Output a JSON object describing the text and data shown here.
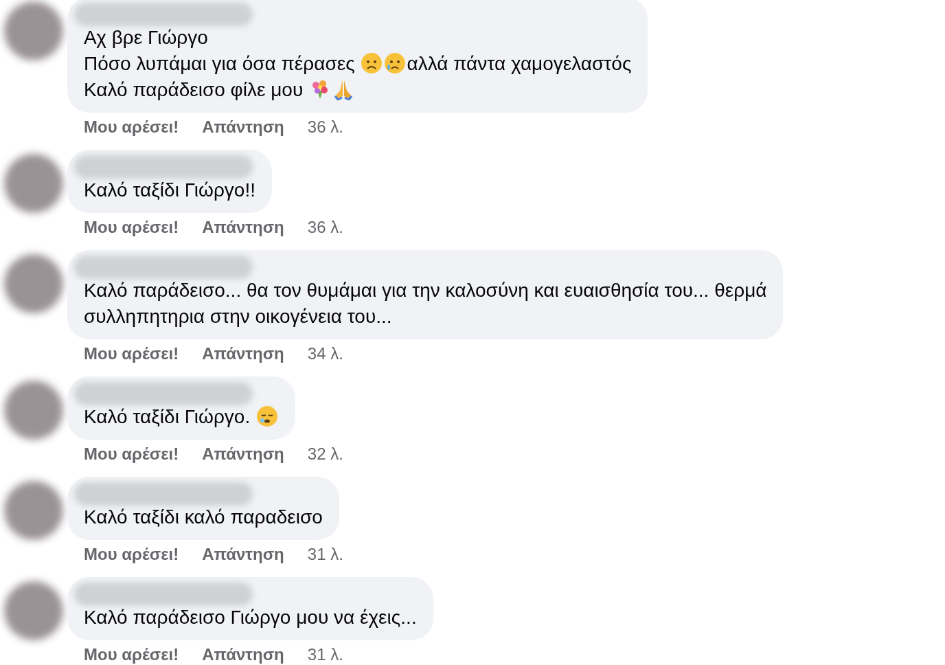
{
  "comments": [
    {
      "lines": [
        [
          {
            "kind": "text",
            "text": "Αχ βρε Γιώργο"
          }
        ],
        [
          {
            "kind": "text",
            "text": "Πόσο λυπάμαι για όσα πέρασες "
          },
          {
            "kind": "worried"
          },
          {
            "kind": "crying"
          },
          {
            "kind": "text",
            "text": "αλλά πάντα χαμογελαστός"
          }
        ],
        [
          {
            "kind": "text",
            "text": "Καλό παράδεισο φίλε μου "
          },
          {
            "kind": "bouquet"
          },
          {
            "kind": "pray"
          }
        ]
      ],
      "like": "Μου αρέσει!",
      "reply": "Απάντηση",
      "time": "36 λ."
    },
    {
      "lines": [
        [
          {
            "kind": "text",
            "text": "Καλό ταξίδι Γιώργο!!"
          }
        ]
      ],
      "like": "Μου αρέσει!",
      "reply": "Απάντηση",
      "time": "36 λ."
    },
    {
      "lines": [
        [
          {
            "kind": "text",
            "text": "Καλό παράδεισο... θα τον θυμάμαι για την καλοσύνη και ευαισθησία του... θερμά"
          }
        ],
        [
          {
            "kind": "text",
            "text": "συλληπητηρια στην οικογένεια του..."
          }
        ]
      ],
      "like": "Μου αρέσει!",
      "reply": "Απάντηση",
      "time": "34 λ."
    },
    {
      "lines": [
        [
          {
            "kind": "text",
            "text": "Καλό ταξίδι Γιώργο. "
          },
          {
            "kind": "sleepy"
          }
        ]
      ],
      "like": "Μου αρέσει!",
      "reply": "Απάντηση",
      "time": "32 λ."
    },
    {
      "lines": [
        [
          {
            "kind": "text",
            "text": "Καλό ταξίδι καλό παραδεισο"
          }
        ]
      ],
      "like": "Μου αρέσει!",
      "reply": "Απάντηση",
      "time": "31 λ."
    },
    {
      "lines": [
        [
          {
            "kind": "text",
            "text": "Καλό παράδεισο Γιώργο μου να έχεις..."
          }
        ]
      ],
      "like": "Μου αρέσει!",
      "reply": "Απάντηση",
      "time": "31 λ."
    }
  ]
}
